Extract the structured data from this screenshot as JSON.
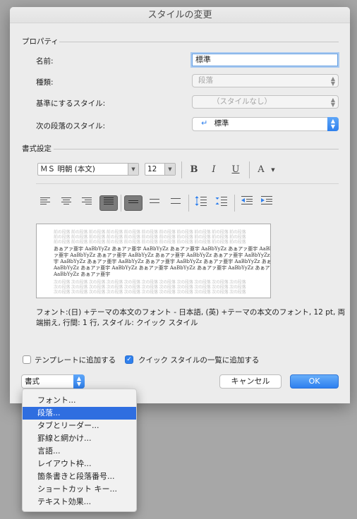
{
  "window": {
    "title": "スタイルの変更"
  },
  "properties": {
    "section_label": "プロパティ",
    "name_label": "名前:",
    "name_value": "標準",
    "kind_label": "種類:",
    "kind_value": "段落",
    "base_label": "基準にするスタイル:",
    "base_value": "（スタイルなし）",
    "next_label": "次の段落のスタイル:",
    "next_value": "標準"
  },
  "format_settings": {
    "section_label": "書式設定",
    "font_value": "ＭＳ 明朝 (本文)",
    "size_value": "12",
    "bold": "B",
    "italic": "I",
    "underline": "U",
    "font_color": "A"
  },
  "preview": {
    "grey_text": "前の段落 前の段落 前の段落 前の段落 前の段落 前の段落 前の段落 前の段落 前の段落 前の段落 前の段落",
    "sample_line_1": "あぁアァ亜宇 AaBbYyZz あぁアァ亜宇 AaBbYyZz あぁアァ亜宇 AaBbYyZz あぁアァ亜宇 AaBbYyZz あぁア",
    "sample_line_2": "ァ亜宇 AaBbYyZz あぁアァ亜宇 AaBbYyZz あぁアァ亜宇 AaBbYyZz あぁアァ亜宇 AaBbYyZz あぁアァ亜",
    "sample_line_3": "宇 AaBbYyZz あぁアァ亜宇 AaBbYyZz あぁアァ亜宇 AaBbYyZz あぁアァ亜宇 AaBbYyZz あぁアァ亜宇",
    "sample_line_4": "AaBbYyZz あぁアァ亜宇 AaBbYyZz あぁアァ亜宇 AaBbYyZz あぁアァ亜宇 AaBbYyZz あぁアァ亜宇",
    "sample_line_5": "AaBbYyZz あぁアァ亜宇",
    "next_grey_text": "次の段落 次の段落 次の段落 次の段落 次の段落 次の段落 次の段落 次の段落 次の段落 次の段落 次の段落"
  },
  "description": "フォント:(日) +テーマの本文のフォント - 日本語, (英) +テーマの本文のフォント, 12 pt, 両端揃え, 行間: 1 行, スタイル: クイック スタイル",
  "options": {
    "add_to_template": "テンプレートに追加する",
    "add_to_quick_styles": "クイック スタイルの一覧に追加する",
    "add_to_template_checked": false,
    "add_to_quick_styles_checked": true
  },
  "format_dropdown": {
    "label": "書式"
  },
  "buttons": {
    "cancel": "キャンセル",
    "ok": "OK"
  },
  "format_menu": {
    "items": [
      "フォント...",
      "段落...",
      "タブとリーダー...",
      "罫線と網かけ...",
      "言語...",
      "レイアウト枠...",
      "箇条書きと段落番号...",
      "ショートカット キー...",
      "テキスト効果..."
    ],
    "selected_index": 1
  },
  "colors": {
    "accent": "#2f80ed",
    "menu_selection": "#2f6ee0",
    "dialog_bg": "#ececec"
  }
}
